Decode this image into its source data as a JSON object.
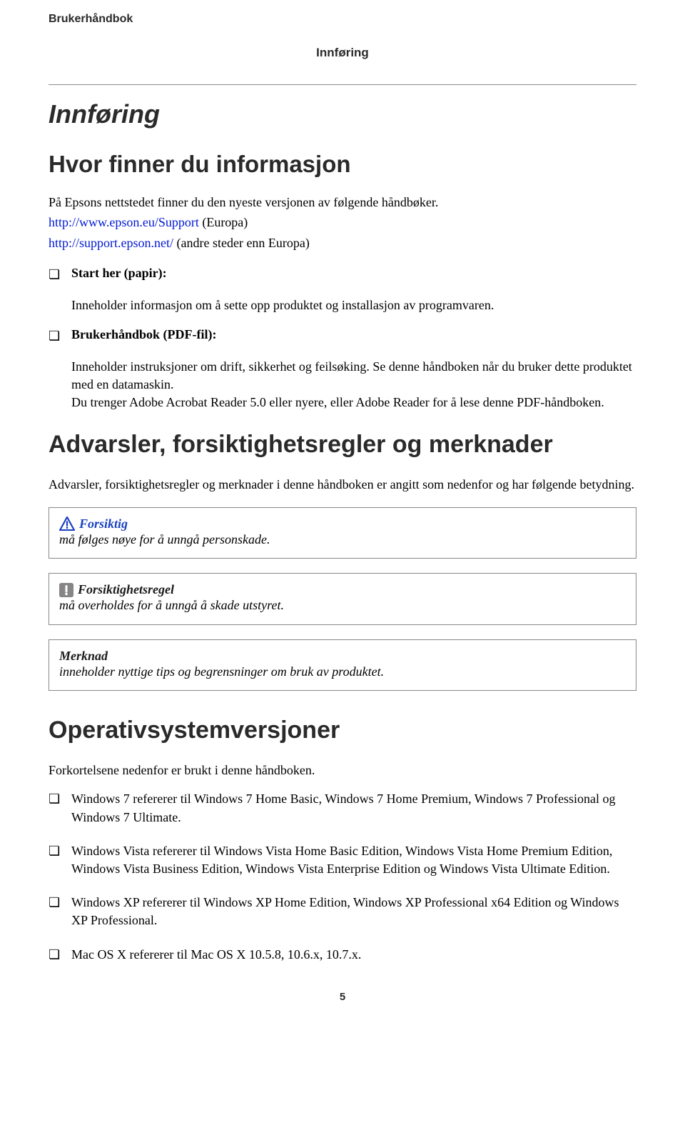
{
  "header": {
    "doc_title": "Brukerhåndbok",
    "section_label": "Innføring"
  },
  "h1": "Innføring",
  "h2_where": "Hvor finner du informasjon",
  "intro_para": "På Epsons nettstedet finner du den nyeste versjonen av følgende håndbøker.",
  "links": {
    "eu_url": "http://www.epson.eu/Support",
    "eu_suffix": " (Europa)",
    "other_url": "http://support.epson.net/",
    "other_suffix": " (andre steder enn Europa)"
  },
  "bullets": [
    {
      "title": "Start her (papir):",
      "body": "Inneholder informasjon om å sette opp produktet og installasjon av programvaren."
    },
    {
      "title": "Brukerhåndbok (PDF-fil):",
      "body": "Inneholder instruksjoner om drift, sikkerhet og feilsøking. Se denne håndboken når du bruker dette produktet med en datamaskin.\nDu trenger Adobe Acrobat Reader 5.0 eller nyere, eller Adobe Reader for å lese denne PDF-håndboken."
    }
  ],
  "h2_warn": "Advarsler, forsiktighetsregler og merknader",
  "warn_intro": "Advarsler, forsiktighetsregler og merknader i denne håndboken er angitt som nedenfor og har følgende betydning.",
  "notes": {
    "forsiktig": {
      "title": "Forsiktig",
      "body": "må følges nøye for å unngå personskade."
    },
    "regel": {
      "title": "Forsiktighetsregel",
      "body": "må overholdes for å unngå å skade utstyret."
    },
    "merknad": {
      "title": "Merknad",
      "body": "inneholder nyttige tips og begrensninger om bruk av produktet."
    }
  },
  "h2_os": "Operativsystemversjoner",
  "os_intro": "Forkortelsene nedenfor er brukt i denne håndboken.",
  "os_items": [
    "Windows 7 refererer til Windows 7 Home Basic, Windows 7 Home Premium, Windows 7 Professional og Windows 7 Ultimate.",
    "Windows Vista refererer til Windows Vista Home Basic Edition, Windows Vista Home Premium Edition, Windows Vista Business Edition, Windows Vista Enterprise Edition og Windows Vista Ultimate Edition.",
    "Windows XP refererer til Windows XP Home Edition, Windows XP Professional x64 Edition og Windows XP Professional.",
    "Mac OS X refererer til Mac OS X 10.5.8, 10.6.x, 10.7.x."
  ],
  "page_number": "5"
}
